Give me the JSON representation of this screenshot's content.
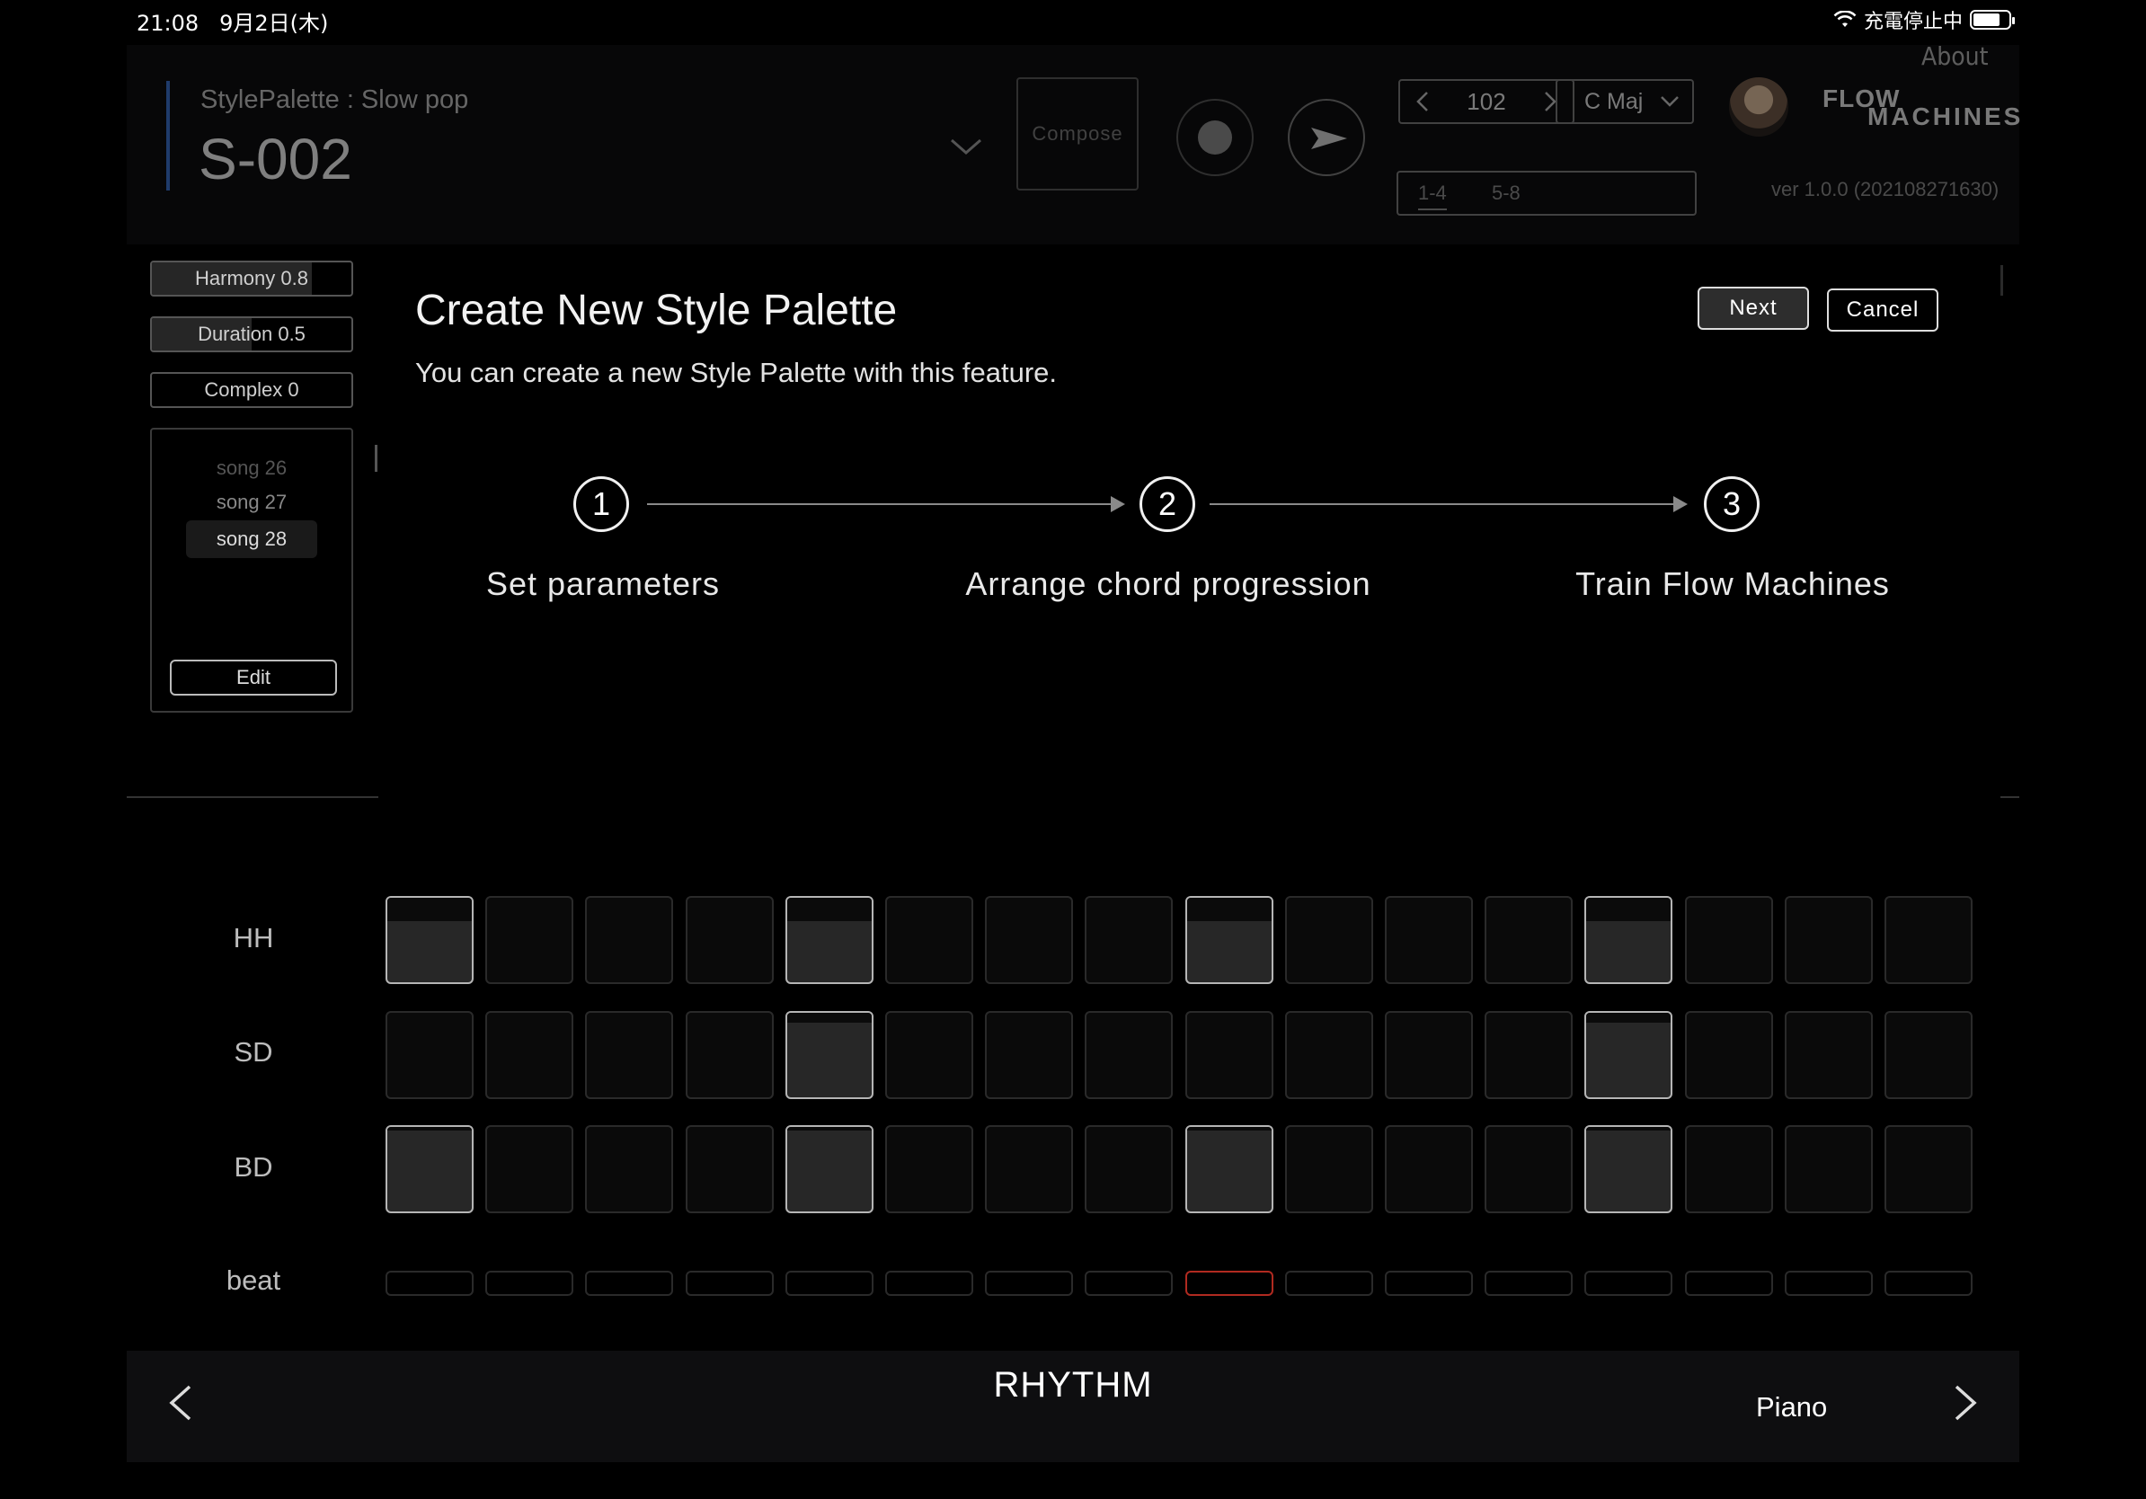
{
  "status": {
    "time": "21:08",
    "date": "9月2日(木)",
    "charging": "充電停止中"
  },
  "header": {
    "palette_title": "StylePalette : Slow pop",
    "song_id": "S-002",
    "compose_label": "Compose",
    "tempo": "102",
    "key": "C Maj",
    "logo_line1": "FLOW",
    "logo_line2": "MACHINES",
    "about_label": "About",
    "bar_range_1": "1-4",
    "bar_range_2": "5-8",
    "version": "ver 1.0.0 (202108271630)"
  },
  "params": [
    {
      "label": "Harmony  0.8",
      "value": 0.8
    },
    {
      "label": "Duration 0.5",
      "value": 0.5
    },
    {
      "label": "Complex 0",
      "value": 0
    }
  ],
  "songs": [
    "song 26",
    "song 27",
    "song 28"
  ],
  "edit_label": "Edit",
  "dialog": {
    "title": "Create New Style Palette",
    "subtitle": "You can create a new Style Palette with this feature.",
    "next_label": "Next",
    "cancel_label": "Cancel",
    "steps": [
      {
        "number": "1",
        "label": "Set parameters"
      },
      {
        "number": "2",
        "label": "Arrange chord progression"
      },
      {
        "number": "3",
        "label": "Train Flow Machines"
      }
    ]
  },
  "rhythm": {
    "rows": [
      {
        "label": "HH",
        "kind": "hat",
        "steps": [
          1,
          0,
          0,
          0,
          1,
          0,
          0,
          0,
          1,
          0,
          0,
          0,
          1,
          0,
          0,
          0
        ]
      },
      {
        "label": "SD",
        "kind": "snare",
        "steps": [
          0,
          0,
          0,
          0,
          1,
          0,
          0,
          0,
          0,
          0,
          0,
          0,
          1,
          0,
          0,
          0
        ]
      },
      {
        "label": "BD",
        "kind": "kick",
        "steps": [
          1,
          0,
          0,
          0,
          1,
          0,
          0,
          0,
          1,
          0,
          0,
          0,
          1,
          0,
          0,
          0
        ]
      }
    ],
    "beat_label": "beat",
    "beat_count": 16,
    "current_beat": 9
  },
  "footer": {
    "mode": "RHYTHM",
    "next_mode": "Piano"
  }
}
